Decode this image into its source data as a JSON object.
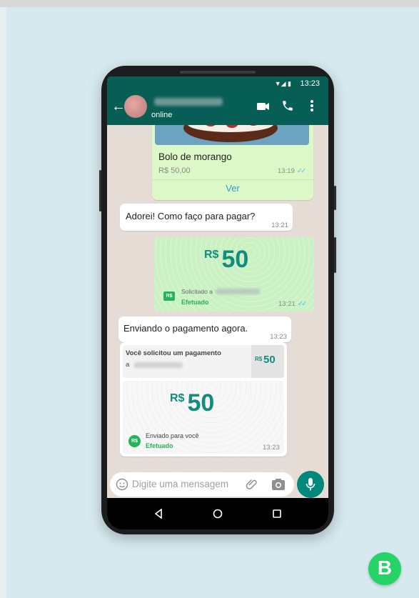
{
  "status_bar": {
    "time": "13:23"
  },
  "header": {
    "status": "online"
  },
  "product": {
    "name": "Bolo de morango",
    "price": "R$ 50,00",
    "time": "13:19",
    "view_label": "Ver"
  },
  "messages": {
    "m1": {
      "text": "Adorei! Como faço para pagar?",
      "time": "13:21"
    },
    "m2": {
      "text": "Enviando o pagamento agora.",
      "time": "13:23"
    }
  },
  "request_card": {
    "currency": "R$",
    "amount": "50",
    "requested_label": "Solicitado a",
    "status": "Efetuado",
    "time": "13:21"
  },
  "payment_card": {
    "header_text": "Você solicitou um pagamento",
    "header_sub": "a",
    "mini_currency": "R$",
    "mini_amount": "50",
    "currency": "R$",
    "amount": "50",
    "sent_label": "Enviado para você",
    "status": "Efetuado",
    "time": "13:23"
  },
  "composer": {
    "placeholder": "Digite uma mensagem"
  },
  "badges": {
    "rs": "R$"
  },
  "brand": {
    "letter": "B"
  },
  "colors": {
    "header": "#075e54",
    "accent": "#128c7e",
    "bubble_out": "#dcf8c6",
    "brand": "#25d366"
  }
}
